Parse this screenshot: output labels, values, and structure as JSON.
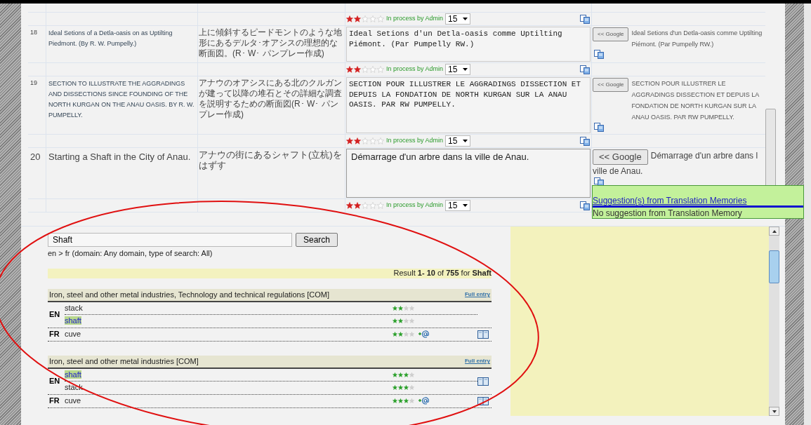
{
  "rows": [
    {
      "kind": "status",
      "stars": 2,
      "status": "In process by Admin",
      "select": "15"
    },
    {
      "kind": "segment",
      "focused": false,
      "number": "18",
      "source": "Ideal Setions of a Detla-oasis on as Uptilting Piedmont. (By R. W. Pumpelly.)",
      "japanese": "上に傾斜するピードモントのような地形にあるデルタ･オアシスの理想的な断面図。(R･ W･ パンプレー作成)",
      "translation": "Ideal Setions d'un Detla-oasis comme Uptilting Piémont. (Par Pumpelly RW.)",
      "google_button": "<< Google",
      "google_text": "Ideal Setions d'un Detla-oasis comme Uptilting Piémont. (Par Pumpelly RW.)"
    },
    {
      "kind": "status",
      "stars": 2,
      "status": "In process by Admin",
      "select": "15"
    },
    {
      "kind": "segment",
      "focused": false,
      "number": "19",
      "source": "SECTION TO ILLUSTRATE THE AGGRADINGS AND DISSECTIONS SINCE FOUNDING OF THE NORTH KURGAN ON THE ANAU OASIS. BY R. W. PUMPELLY.",
      "japanese": "アナウのオアシスにある北のクルガンが建って以降の堆石とその詳細な調査を説明するための断面図(R･ W･ パンプレー作成)",
      "translation": "SECTION POUR ILLUSTRER LE AGGRADINGS DISSECTION ET DEPUIS LA FONDATION DE NORTH KURGAN SUR LA ANAU OASIS. PAR RW PUMPELLY.",
      "google_button": "<< Google",
      "google_text": "SECTION POUR ILLUSTRER LE AGGRADINGS DISSECTION ET DEPUIS LA FONDATION DE NORTH KURGAN SUR LA ANAU OASIS. PAR RW PUMPELLY."
    },
    {
      "kind": "status",
      "stars": 2,
      "status": "In process by Admin",
      "select": "15"
    },
    {
      "kind": "segment",
      "focused": true,
      "number": "20",
      "source": "Starting a Shaft in the City of Anau.",
      "japanese": "アナウの街にあるシャフト(立杭)をはずす",
      "translation": "Démarrage d'un arbre dans la ville de Anau.",
      "google_button": "<< Google",
      "google_text": "Démarrage d'un arbre dans l",
      "google_text_2": "ville de Anau."
    },
    {
      "kind": "status",
      "stars": 2,
      "status": "In process by Admin",
      "select": "15"
    }
  ],
  "suggestions": {
    "title": "Suggestion(s) from Translation Memories",
    "message": "No suggestion from Translation Memory"
  },
  "search": {
    "value": "Shaft",
    "button": "Search",
    "info": "en > fr (domain: Any domain, type of search: All)",
    "result": "Result **1- 10** of **755** for **Shaft**"
  },
  "entries": [
    {
      "title": "Iron, steel and other metal industries, Technology and technical regulations [COM]",
      "link": "Full entry",
      "languages": [
        {
          "code": "EN",
          "book": false,
          "terms": [
            {
              "text": "stack",
              "highlighted": false,
              "stars": 2,
              "email": false
            },
            {
              "text": "shaft",
              "highlighted": true,
              "stars": 2,
              "email": false
            }
          ]
        },
        {
          "code": "FR",
          "book": true,
          "terms": [
            {
              "text": "cuve",
              "highlighted": false,
              "stars": 2,
              "email": true
            }
          ]
        }
      ]
    },
    {
      "title": "Iron, steel and other metal industries [COM]",
      "link": "Full entry",
      "languages": [
        {
          "code": "EN",
          "book": true,
          "terms": [
            {
              "text": "shaft",
              "highlighted": true,
              "stars": 3,
              "email": false
            },
            {
              "text": "stack",
              "highlighted": false,
              "stars": 3,
              "email": false
            }
          ]
        },
        {
          "code": "FR",
          "book": true,
          "terms": [
            {
              "text": "cuve",
              "highlighted": false,
              "stars": 3,
              "email": true
            }
          ]
        }
      ]
    }
  ]
}
